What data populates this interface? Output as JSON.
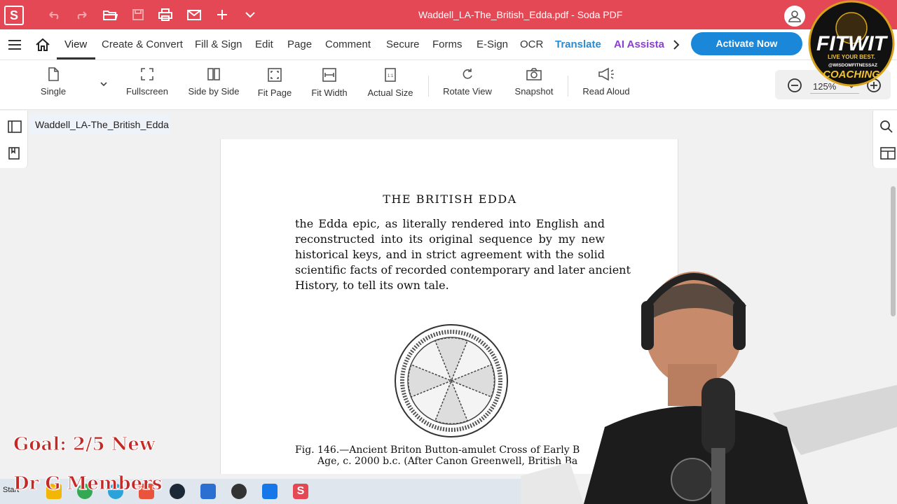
{
  "app": {
    "window_title": "Waddell_LA-The_British_Edda.pdf   -   Soda PDF",
    "logo_letter": "S"
  },
  "menu": {
    "items": [
      "View",
      "Create & Convert",
      "Fill & Sign",
      "Edit",
      "Page",
      "Comment",
      "Secure",
      "Forms",
      "E-Sign",
      "OCR",
      "Translate",
      "AI Assista"
    ],
    "active": "View",
    "activate_label": "Activate Now"
  },
  "toolbar": {
    "buttons": [
      {
        "label": "Single",
        "icon": "page-icon"
      },
      {
        "label": "Fullscreen",
        "icon": "fullscreen-icon"
      },
      {
        "label": "Side by Side",
        "icon": "side-by-side-icon"
      },
      {
        "label": "Fit Page",
        "icon": "fit-page-icon"
      },
      {
        "label": "Fit Width",
        "icon": "fit-width-icon"
      },
      {
        "label": "Actual Size",
        "icon": "actual-size-icon"
      },
      {
        "label": "Rotate View",
        "icon": "rotate-icon"
      },
      {
        "label": "Snapshot",
        "icon": "camera-icon"
      },
      {
        "label": "Read Aloud",
        "icon": "megaphone-icon"
      }
    ],
    "zoom": "125%",
    "actual_size_glyph": "1:1"
  },
  "document": {
    "tab_name": "Waddell_LA-The_British_Edda",
    "running_head": "THE BRITISH EDDA",
    "body_lines": [
      "the Edda epic, as literally rendered into English and",
      "reconstructed into its original sequence by my new",
      "historical keys, and in strict agreement with the solid",
      "scientific facts of recorded contemporary and later ancient",
      "History, to tell its own tale."
    ],
    "caption_lines": [
      "Fig. 146.—Ancient Briton Button-amulet Cross of Early B",
      "Age, c. 2000 b.c.   (After Canon Greenwell, British Ba"
    ]
  },
  "overlay": {
    "goal_text": "Goal: 2/5 New",
    "members_text": "Dr G Members",
    "brand_name": "FITWIT",
    "brand_tagline": "LIVE YOUR BEST.",
    "brand_handle": "@WISDOMFITNESSAZ",
    "brand_sub": "COACHING"
  },
  "taskbar": {
    "start_label": "Start"
  },
  "colors": {
    "titlebar": "#e44855",
    "activate": "#1b87d9",
    "translate": "#2a8bd0",
    "ai": "#8a3fd1"
  }
}
